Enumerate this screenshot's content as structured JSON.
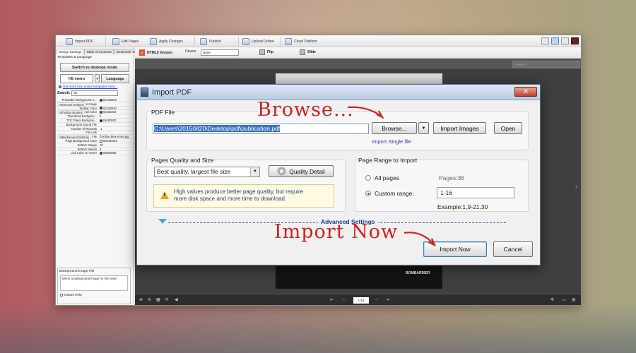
{
  "toolbar": {
    "items": [
      "Import PDF",
      "Edit Pages",
      "Apply Changes",
      "Publish",
      "Upload Online",
      "Cloud Platform"
    ]
  },
  "left_panel": {
    "tabs": [
      "Design Settings",
      "Table of Contents",
      "Bookmark Tabs"
    ],
    "section": "Templates & Language",
    "switch_button": "Switch to desktop mode",
    "template": "H5 metro",
    "language_button": "Language",
    "more_templates_link": "Get more free online templates here...",
    "search_label": "Search:",
    "search_value": "bk",
    "props": [
      {
        "k": "Preloader Background C...",
        "v": "0x232B30",
        "sw": "#232B30"
      },
      {
        "k": "⊟Toolbar Settings",
        "v": "",
        "grp": true
      },
      {
        "k": "⊟General Settings",
        "v": "",
        "grp": true
      },
      {
        "k": "Logo Image",
        "v": ""
      },
      {
        "k": "Toolbar Color",
        "v": "0x232B30",
        "sw": "#232B30"
      },
      {
        "k": "⊟Toolbar Buttons",
        "v": "",
        "grp": true
      },
      {
        "k": "Thumbnail Color",
        "v": "0x333333",
        "sw": "#333333"
      },
      {
        "k": "Thumbnail Backgrou...",
        "v": "0",
        "sw": ""
      },
      {
        "k": "TOC Panel Backgrou...",
        "v": "0x000000",
        "sw": "#000000"
      },
      {
        "k": "Background Sound File",
        "v": ""
      },
      {
        "k": "Number of Repeats",
        "v": "-1"
      },
      {
        "k": "File Link",
        "v": ""
      },
      {
        "k": "⊟Background Settings",
        "v": "",
        "grp": true
      },
      {
        "k": "Background Image File",
        "v": "\\fxs\\t\\pu-blue-inner.jpg",
        "sw": ""
      },
      {
        "k": "Page Background Color",
        "v": "0xE3E3E3",
        "sw": "#E3E3E3"
      },
      {
        "k": "Bottom Margin",
        "v": "10"
      },
      {
        "k": "Bottom Margin",
        "v": "0"
      },
      {
        "k": "Link Color on Hover",
        "v": "0x800080",
        "sw": "#800080"
      }
    ],
    "help_title": "Background Image File",
    "help_desc": "Select a background image for the book",
    "instant_help": "Instant Help"
  },
  "preview": {
    "html5_label": "HTML5 Version",
    "device_label": "Device:",
    "device_value": "None",
    "flip_label": "Flip",
    "slide_label": "Slide",
    "search_placeholder": "Search",
    "brand_text": "BOMBARDIER",
    "page_indicator": "1/16"
  },
  "dialog": {
    "title": "Import PDF",
    "close": "✕",
    "pdf_group": "PDF File",
    "path_value": "C:\\Users\\20150820\\Desktop\\pdf\\publication.pdf",
    "browse_button": "Browse...",
    "images_button": "Import Images",
    "open_button": "Open",
    "single_file_link": "Import Single file",
    "quality_group": "Pages Quality and Size",
    "quality_value": "Best quality, largest file size",
    "quality_detail_button": "Quality Detail",
    "warning_line1": "High values produce better page quality, but require",
    "warning_line2": "more disk space and more time to download.",
    "range_group": "Page Range to Import",
    "all_pages": "All pages",
    "pages_count": "Pages:36",
    "custom_range": "Custom range:",
    "range_value": "1-16",
    "example": "Example:1,9-21,30",
    "advanced": "Advanced Settings",
    "import_now_button": "Import Now",
    "cancel_button": "Cancel"
  },
  "annotations": {
    "browse": "Browse...",
    "import_now": "Import Now"
  },
  "colors": {
    "annotation_red": "#d0221f",
    "selection_blue": "#3a6fc9",
    "link_blue": "#1b3fa8"
  }
}
